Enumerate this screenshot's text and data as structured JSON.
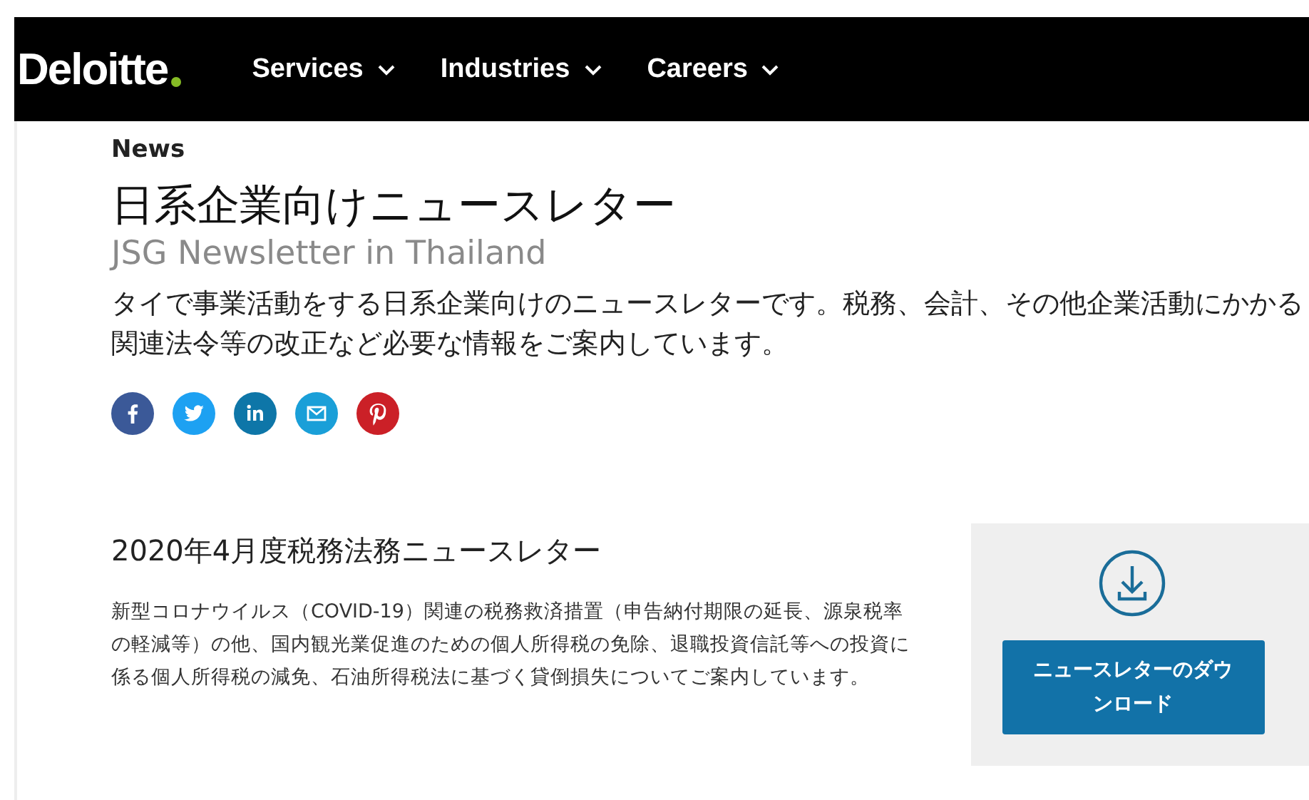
{
  "nav": {
    "logo": "Deloitte",
    "items": [
      {
        "label": "Services"
      },
      {
        "label": "Industries"
      },
      {
        "label": "Careers"
      }
    ]
  },
  "breadcrumb": "News",
  "title": "日系企業向けニュースレター",
  "subtitle": "JSG Newsletter in Thailand",
  "intro": "タイで事業活動をする日系企業向けのニュースレターです。税務、会計、その他企業活動にかかる関連法令等の改正など必要な情報をご案内しています。",
  "share": [
    {
      "kind": "facebook",
      "color": "#3b5998"
    },
    {
      "kind": "twitter",
      "color": "#1da1f2"
    },
    {
      "kind": "linkedin",
      "color": "#0e76a8"
    },
    {
      "kind": "email",
      "color": "#1a9fd8"
    },
    {
      "kind": "pinterest",
      "color": "#cb2027"
    }
  ],
  "article": {
    "heading": "2020年4月度税務法務ニュースレター",
    "body": "新型コロナウイルス（COVID-19）関連の税務救済措置（申告納付期限の延長、源泉税率の軽減等）の他、国内観光業促進のための個人所得税の免除、退職投資信託等への投資に係る個人所得税の減免、石油所得税法に基づく貸倒損失についてご案内しています。"
  },
  "download": {
    "button": "ニュースレターのダウンロード"
  }
}
